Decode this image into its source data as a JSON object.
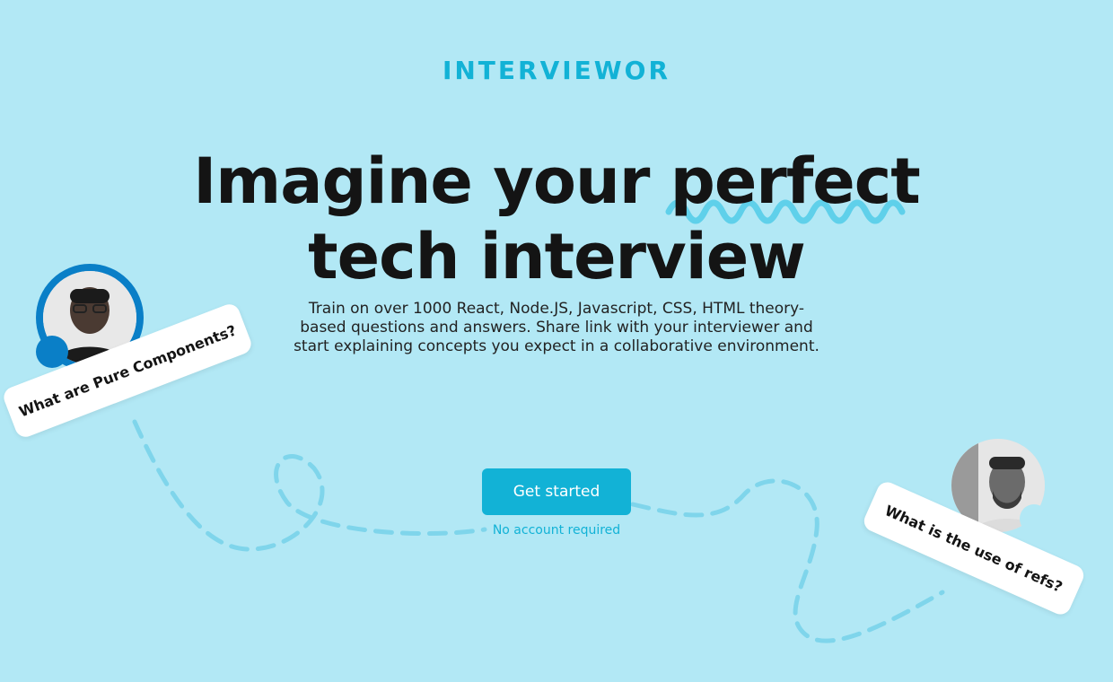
{
  "header": {
    "logo_text": "INTERVIEWOR"
  },
  "hero": {
    "headline_line1": "Imagine your perfect",
    "headline_line2": "tech interview",
    "description": "Train on over 1000 React, Node.JS, Javascript, CSS, HTML theory-based questions and answers. Share link with your interviewer and start explaining concepts you expect in a collaborative environment.",
    "cta_label": "Get started",
    "cta_note": "No account required"
  },
  "bubbles": {
    "left_question": "What are Pure Components?",
    "right_question": "What is the use of refs?"
  },
  "colors": {
    "background": "#b2e8f5",
    "accent": "#12b2d6",
    "avatar_ring": "#0a7fc7",
    "headline": "#141414",
    "wave": "#5fd0ea"
  },
  "icons": {
    "left_avatar": "person-avatar",
    "right_avatar": "person-avatar"
  }
}
